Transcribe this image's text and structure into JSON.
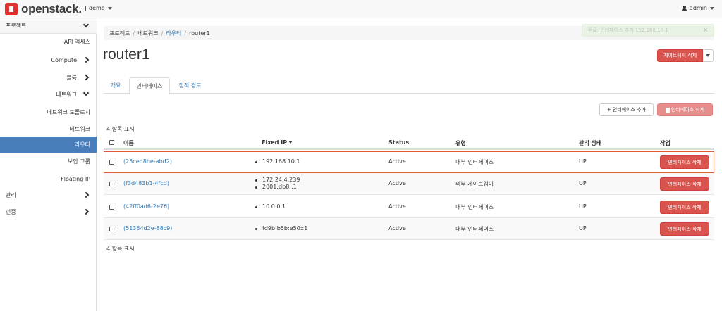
{
  "topbar": {
    "brand": "openstack.",
    "project": "demo",
    "user": "admin"
  },
  "sidebar": {
    "project": "프로젝트",
    "items": [
      {
        "label": "API 액세스"
      },
      {
        "label": "Compute"
      },
      {
        "label": "볼륨"
      },
      {
        "label": "네트워크"
      },
      {
        "label": "네트워크 토폴로지"
      },
      {
        "label": "네트워크"
      },
      {
        "label": "라우터"
      },
      {
        "label": "보안 그룹"
      },
      {
        "label": "Floating IP"
      },
      {
        "label": "관리"
      },
      {
        "label": "인증"
      }
    ]
  },
  "breadcrumb": {
    "items": [
      "프로젝트",
      "네트워크",
      "라우터",
      "router1"
    ]
  },
  "toast": {
    "text": "완료: 인터페이스 추가 192.168.10.1",
    "close": "×"
  },
  "page": {
    "title": "router1",
    "delete_gateway": "게이트웨이 삭제"
  },
  "tabs": [
    "개요",
    "인터페이스",
    "정적 경로"
  ],
  "actions": {
    "add_interface": "인터페이스 추가",
    "delete_interfaces": "인터페이스 삭제"
  },
  "count_label": "4 항목 표시",
  "table": {
    "columns": [
      "이름",
      "Fixed IP",
      "Status",
      "유형",
      "관리 상태",
      "작업"
    ],
    "rows": [
      {
        "name": "(23ced8be-abd2)",
        "ips": [
          "192.168.10.1"
        ],
        "status": "Active",
        "type": "내부 인터페이스",
        "admin_state": "UP",
        "action": "인터페이스 삭제"
      },
      {
        "name": "(f3d483b1-4fcd)",
        "ips": [
          "172.24.4.239",
          "2001:db8::1"
        ],
        "status": "Active",
        "type": "외부 게이트웨이",
        "admin_state": "UP",
        "action": "인터페이스 삭제"
      },
      {
        "name": "(42ff0ad6-2e76)",
        "ips": [
          "10.0.0.1"
        ],
        "status": "Active",
        "type": "내부 인터페이스",
        "admin_state": "UP",
        "action": "인터페이스 삭제"
      },
      {
        "name": "(51354d2e-88c9)",
        "ips": [
          "fd9b:b5b:e50::1"
        ],
        "status": "Active",
        "type": "내부 인터페이스",
        "admin_state": "UP",
        "action": "인터페이스 삭제"
      }
    ]
  },
  "colors": {
    "brand": "#e0322f",
    "active_nav": "#4a7ebb",
    "danger": "#d9534f",
    "link": "#337ab7",
    "highlight": "#e25c3c"
  }
}
